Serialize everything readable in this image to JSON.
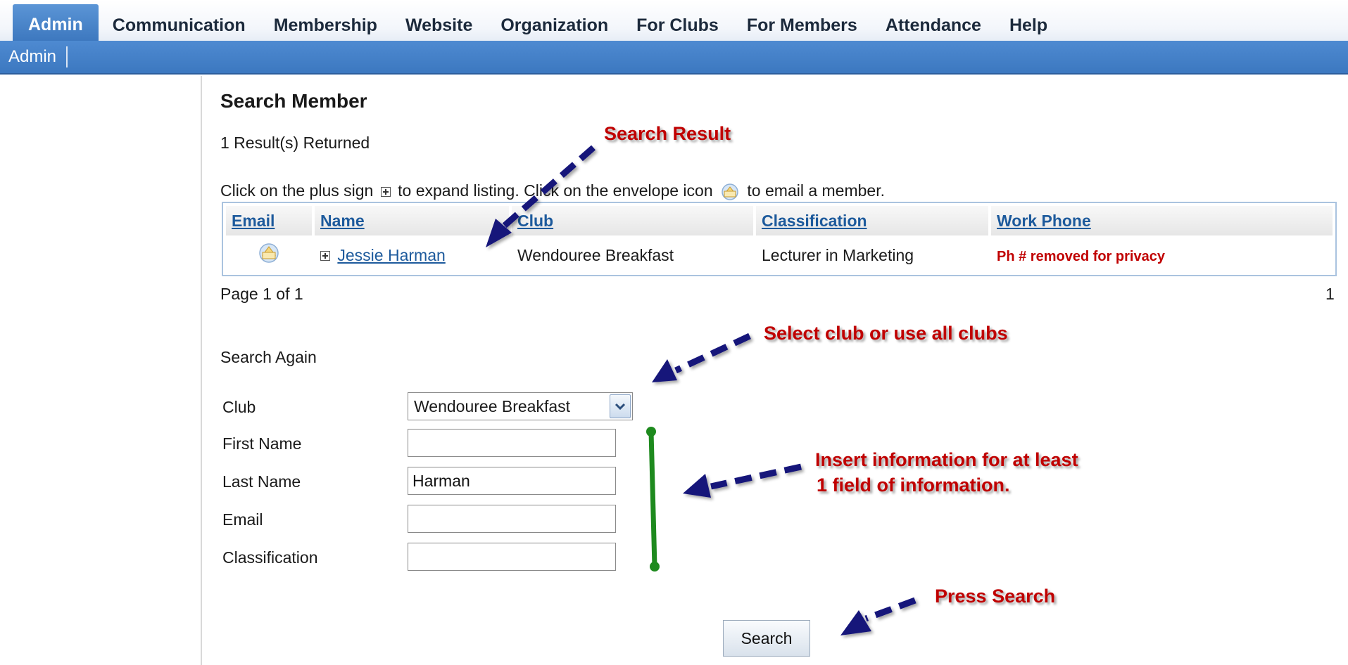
{
  "nav": {
    "tabs": [
      {
        "label": "Admin",
        "active": true
      },
      {
        "label": "Communication"
      },
      {
        "label": "Membership"
      },
      {
        "label": "Website"
      },
      {
        "label": "Organization"
      },
      {
        "label": "For Clubs"
      },
      {
        "label": "For Members"
      },
      {
        "label": "Attendance"
      },
      {
        "label": "Help"
      }
    ],
    "subnav": [
      "Admin"
    ]
  },
  "page": {
    "title": "Search Member",
    "result_count": "1 Result(s) Returned",
    "instructions": {
      "part1": "Click on the plus sign",
      "part2": "to expand listing. Click on the envelope icon",
      "part3": "to email a member."
    }
  },
  "table": {
    "headers": [
      "Email",
      "Name",
      "Club",
      "Classification",
      "Work Phone"
    ],
    "rows": [
      {
        "name": "Jessie Harman",
        "club": "Wendouree Breakfast",
        "classification": "Lecturer in Marketing",
        "work_phone": "Ph # removed for privacy"
      }
    ],
    "pager_left": "Page 1 of 1",
    "pager_right": "1"
  },
  "search_form": {
    "title": "Search Again",
    "club_label": "Club",
    "club_value": "Wendouree Breakfast",
    "first_name_label": "First Name",
    "first_name_value": "",
    "last_name_label": "Last Name",
    "last_name_value": "Harman",
    "email_label": "Email",
    "email_value": "",
    "classification_label": "Classification",
    "classification_value": "",
    "search_label": "Search"
  },
  "annotations": {
    "search_result": "Search Result",
    "select_club": "Select club or use all clubs",
    "insert_info_line1": "Insert information for at least",
    "insert_info_line2": "1 field of information.",
    "press_search": "Press Search"
  },
  "colors": {
    "annotation": "#c00000",
    "arrow": "#12127a",
    "bracket": "#1e8a1e",
    "nav_blue": "#3c78c0"
  }
}
